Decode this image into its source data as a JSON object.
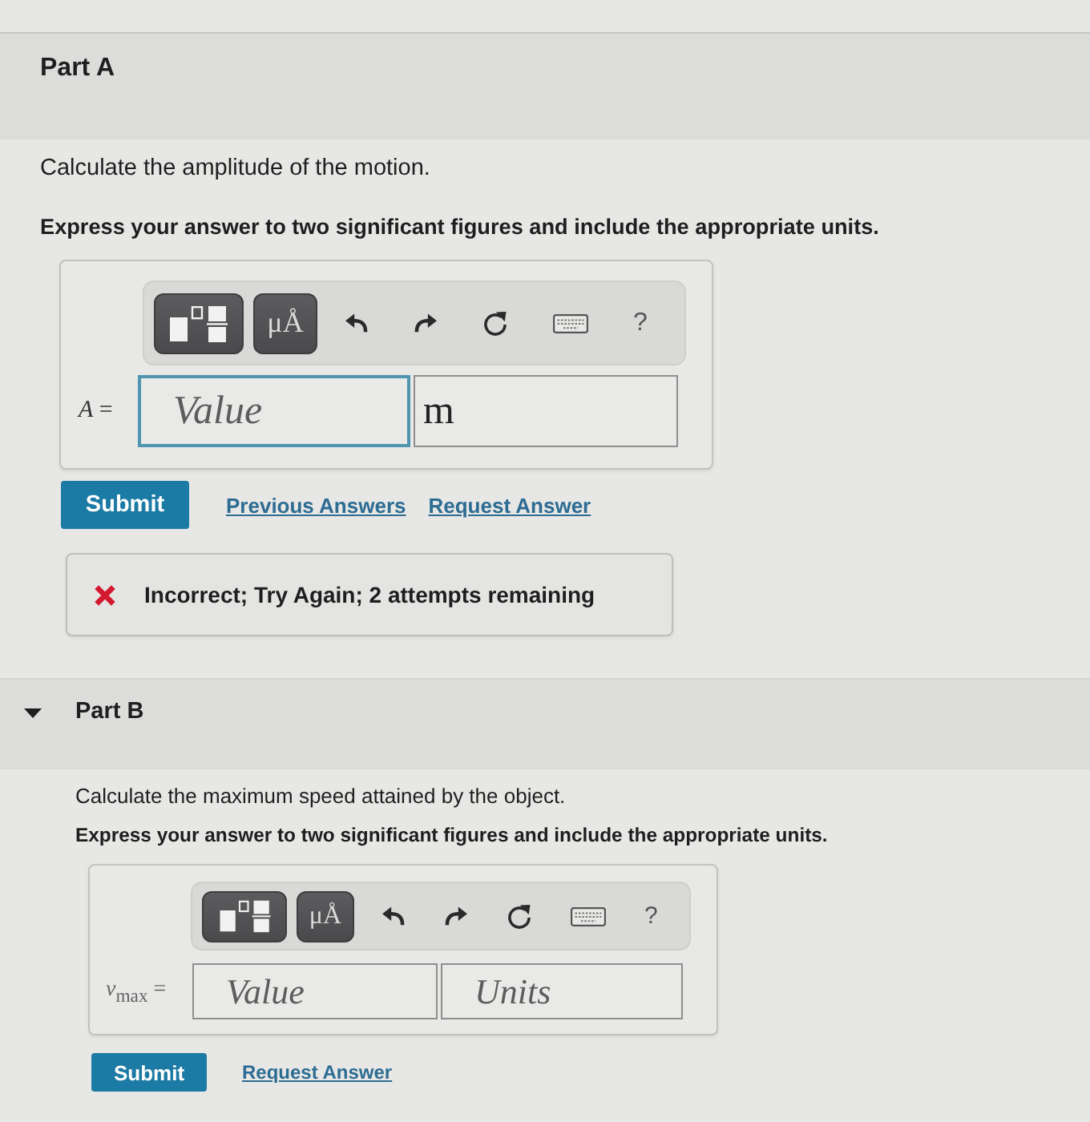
{
  "parts": [
    {
      "title": "Part A",
      "question": "Calculate the amplitude of the motion.",
      "instruction": "Express your answer to two significant figures and include the appropriate units.",
      "toolbar": [
        {
          "kind": "templates"
        },
        {
          "kind": "symbols",
          "label": "μÅ"
        },
        {
          "kind": "undo"
        },
        {
          "kind": "redo"
        },
        {
          "kind": "reset"
        },
        {
          "kind": "keyboard"
        },
        {
          "kind": "help",
          "label": "?"
        }
      ],
      "answer": {
        "label": "*A* =",
        "fields": [
          {
            "kind": "value",
            "placeholder": "Value",
            "focused": true
          },
          {
            "kind": "units",
            "value": "m",
            "focused": false
          }
        ]
      },
      "actions": [
        {
          "kind": "submit",
          "label": "Submit"
        },
        {
          "kind": "link",
          "label": "Previous Answers"
        },
        {
          "kind": "link",
          "label": "Request Answer"
        }
      ],
      "feedback": {
        "kind": "incorrect",
        "text": "Incorrect; Try Again; 2 attempts remaining"
      }
    },
    {
      "title": "Part B",
      "expanded": true,
      "question": "Calculate the maximum speed attained by the object.",
      "instruction": "Express your answer to two significant figures and include the appropriate units.",
      "toolbar": [
        {
          "kind": "templates"
        },
        {
          "kind": "symbols",
          "label": "μÅ"
        },
        {
          "kind": "undo"
        },
        {
          "kind": "redo"
        },
        {
          "kind": "reset"
        },
        {
          "kind": "keyboard"
        },
        {
          "kind": "help",
          "label": "?"
        }
      ],
      "answer": {
        "label": "*v*$_{max}$ =",
        "fields": [
          {
            "kind": "value",
            "placeholder": "Value",
            "focused": false
          },
          {
            "kind": "units",
            "placeholder": "Units",
            "focused": false
          }
        ]
      },
      "actions": [
        {
          "kind": "submit",
          "label": "Submit"
        },
        {
          "kind": "link",
          "label": "Request Answer"
        }
      ]
    }
  ]
}
